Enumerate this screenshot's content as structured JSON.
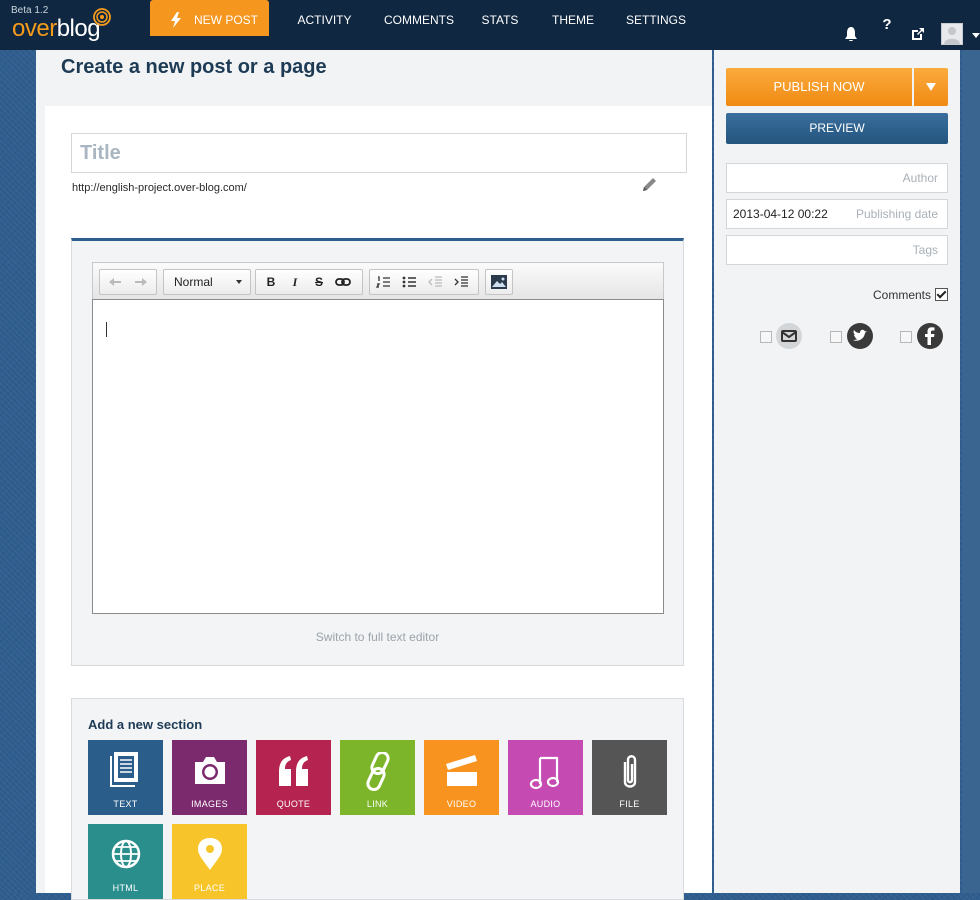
{
  "brand": {
    "beta": "Beta 1.2",
    "name_over": "over",
    "name_blog": "blog"
  },
  "nav": {
    "items": [
      {
        "label": "NEW POST",
        "active": true
      },
      {
        "label": "ACTIVITY"
      },
      {
        "label": "COMMENTS"
      },
      {
        "label": "STATS"
      },
      {
        "label": "THEME"
      },
      {
        "label": "SETTINGS"
      }
    ],
    "right_icons": [
      "bell-icon",
      "help-icon",
      "external-link-icon",
      "avatar"
    ]
  },
  "page": {
    "title": "Create a new post or a page"
  },
  "post": {
    "title_placeholder": "Title",
    "url": "http://english-project.over-blog.com/"
  },
  "editor": {
    "format_select": "Normal",
    "toolbar_icons": [
      "undo-icon",
      "redo-icon",
      "bold-icon",
      "italic-icon",
      "strikethrough-icon",
      "link-icon",
      "ordered-list-icon",
      "unordered-list-icon",
      "outdent-icon",
      "indent-icon",
      "image-icon"
    ],
    "switch_link": "Switch to full text editor"
  },
  "sections": {
    "title": "Add a new section",
    "tiles": [
      {
        "label": "TEXT",
        "color": "#2b5d8a",
        "icon": "document-icon"
      },
      {
        "label": "IMAGES",
        "color": "#7b2a6e",
        "icon": "camera-icon"
      },
      {
        "label": "QUOTE",
        "color": "#b52350",
        "icon": "quote-icon"
      },
      {
        "label": "LINK",
        "color": "#7cb52a",
        "icon": "chain-link-icon"
      },
      {
        "label": "VIDEO",
        "color": "#f7931e",
        "icon": "clapperboard-icon"
      },
      {
        "label": "AUDIO",
        "color": "#c54ab2",
        "icon": "music-note-icon"
      },
      {
        "label": "FILE",
        "color": "#555555",
        "icon": "paperclip-icon"
      },
      {
        "label": "HTML",
        "color": "#2a8f8c",
        "icon": "globe-icon"
      },
      {
        "label": "PLACE",
        "color": "#f7c52a",
        "icon": "map-pin-icon"
      }
    ]
  },
  "sidebar": {
    "publish_label": "PUBLISH NOW",
    "preview_label": "PREVIEW",
    "author_placeholder": "Author",
    "date_value": "2013-04-12 00:22",
    "date_placeholder": "Publishing date",
    "tags_placeholder": "Tags",
    "comments_label": "Comments",
    "comments_checked": true,
    "share": [
      "email-icon",
      "twitter-icon",
      "facebook-icon"
    ]
  },
  "colors": {
    "accent_orange": "#f5961f",
    "nav_bg": "#0f2740",
    "preview_blue": "#2d5f8c"
  }
}
